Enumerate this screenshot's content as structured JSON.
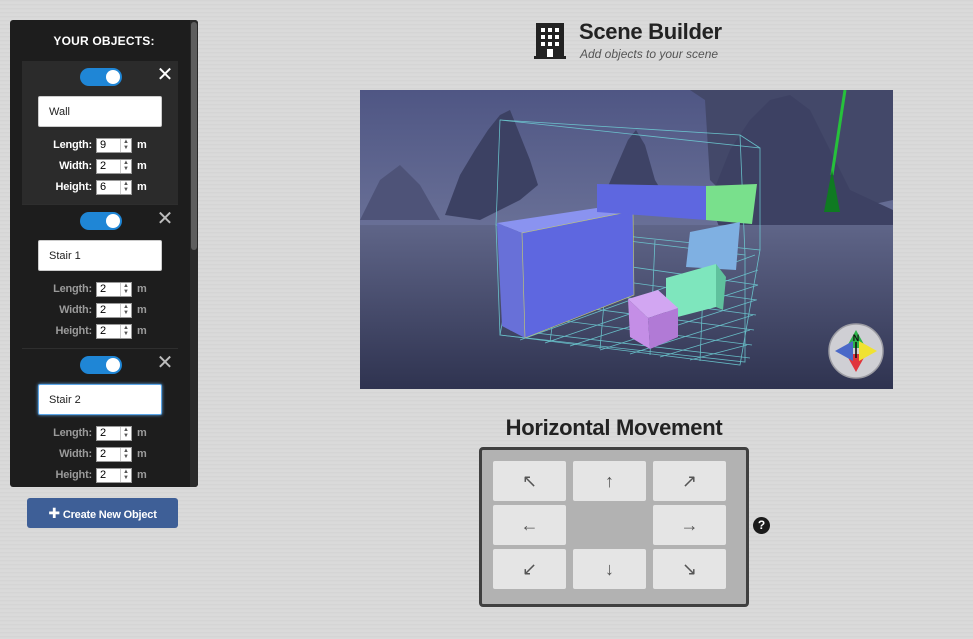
{
  "sidebar": {
    "title": "YOUR OBJECTS:",
    "objects": [
      {
        "name": "Wall",
        "length_label": "Length:",
        "length": "9",
        "width_label": "Width:",
        "width": "2",
        "height_label": "Height:",
        "height": "6",
        "unit": "m",
        "enabled": true,
        "close": "✕"
      },
      {
        "name": "Stair 1",
        "length_label": "Length:",
        "length": "2",
        "width_label": "Width:",
        "width": "2",
        "height_label": "Height:",
        "height": "2",
        "unit": "m",
        "enabled": true,
        "close": "✕"
      },
      {
        "name": "Stair 2",
        "length_label": "Length:",
        "length": "2",
        "width_label": "Width:",
        "width": "2",
        "height_label": "Height:",
        "height": "2",
        "unit": "m",
        "enabled": true,
        "close": "✕"
      }
    ],
    "create_button": "Create New Object"
  },
  "header": {
    "title": "Scene Builder",
    "subtitle": "Add objects to your scene",
    "icon": "building-icon"
  },
  "viewport": {
    "compass_label": "N"
  },
  "movement": {
    "title": "Horizontal Movement",
    "buttons": {
      "up_left": "↖",
      "up": "↑",
      "up_right": "↗",
      "left": "←",
      "right": "→",
      "down_left": "↙",
      "down": "↓",
      "down_right": "↘"
    },
    "help": "?"
  },
  "colors": {
    "toggle": "#1f86d6",
    "create_button": "#3e5f97",
    "wall": "#5e67e0",
    "stair_green": "#79e08c",
    "stair_blue": "#7fb0e2",
    "stair_teal": "#7ee6bd",
    "stair_purple": "#c48ee6"
  }
}
